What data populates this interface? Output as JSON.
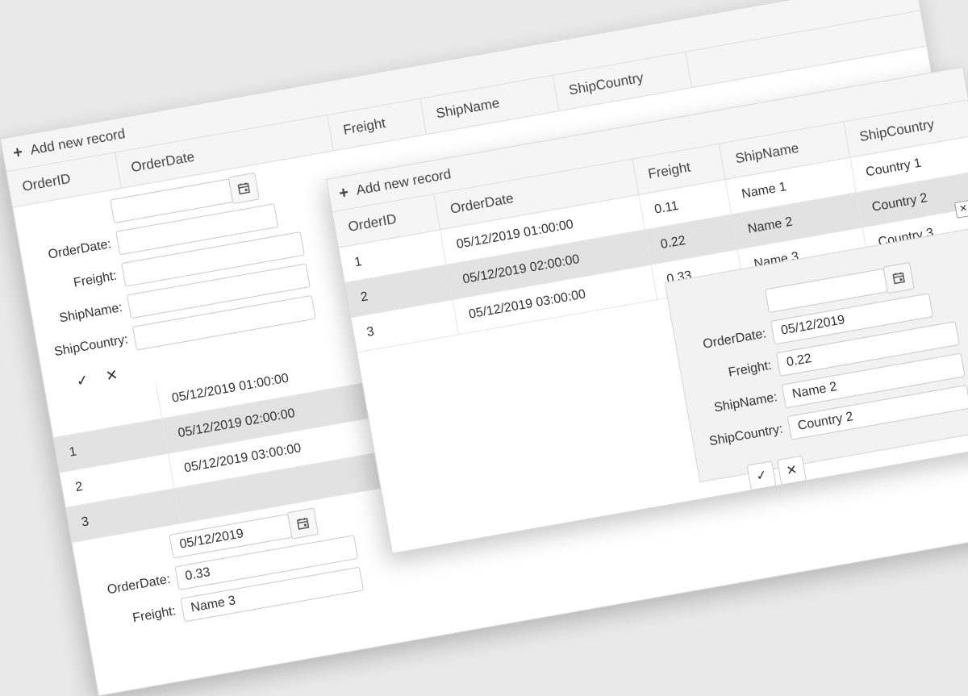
{
  "toolbar": {
    "add_label": "Add new record"
  },
  "columns": [
    "OrderID",
    "OrderDate",
    "Freight",
    "ShipName",
    "ShipCountry"
  ],
  "rows": [
    {
      "id": "1",
      "date": "05/12/2019 01:00:00",
      "freight": "0.11",
      "name": "Name 1",
      "country": "Country 1"
    },
    {
      "id": "2",
      "date": "05/12/2019 02:00:00",
      "freight": "0.22",
      "name": "Name 2",
      "country": "Country 2"
    },
    {
      "id": "3",
      "date": "05/12/2019 03:00:00",
      "freight": "0.33",
      "name": "Name 3",
      "country": "Country 3"
    }
  ],
  "form_labels": {
    "order_date": "OrderDate:",
    "freight": "Freight:",
    "ship_name": "ShipName:",
    "ship_country": "ShipCountry:"
  },
  "back_edit": {
    "order_date": "05/12/2019",
    "freight": "0.33",
    "ship_name": "Name 3"
  },
  "popup_edit": {
    "order_date": "05/12/2019",
    "freight": "0.22",
    "ship_name": "Name 2",
    "ship_country": "Country 2"
  },
  "icons": {
    "check": "check-icon",
    "close": "close-icon",
    "calendar": "calendar-icon",
    "plus": "plus-icon"
  },
  "colors": {
    "header_bg": "#f5f5f5",
    "selected_row": "#e2e2e2",
    "page_bg": "#e9e9e9"
  }
}
